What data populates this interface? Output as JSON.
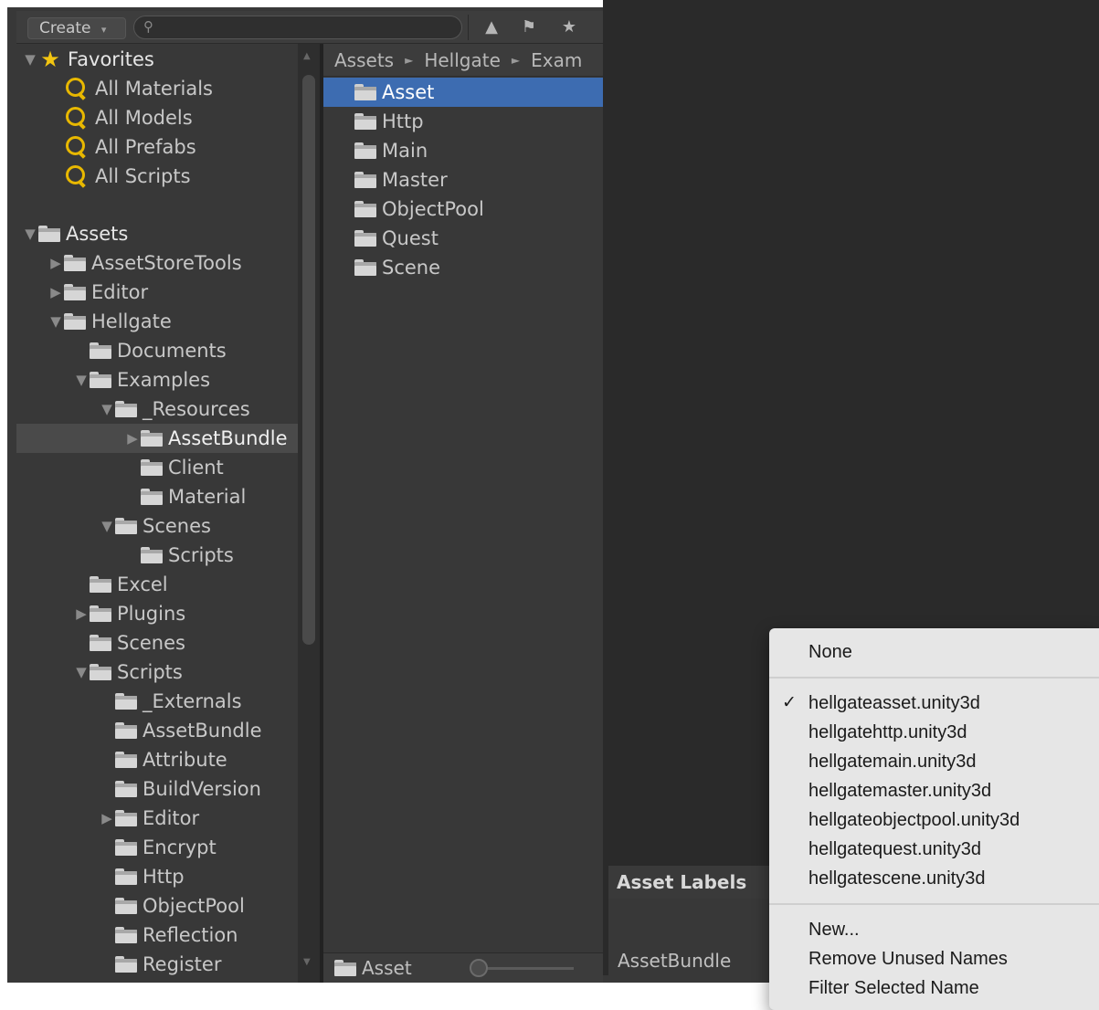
{
  "toolbar": {
    "create_label": "Create",
    "create_arrow": "▾",
    "search_placeholder": "",
    "icons": [
      "filter-by-type-icon",
      "filter-by-label-icon",
      "favorite-icon"
    ]
  },
  "favorites": {
    "title": "Favorites",
    "items": [
      "All Materials",
      "All Models",
      "All Prefabs",
      "All Scripts"
    ]
  },
  "tree": {
    "root": "Assets",
    "rows": [
      {
        "label": "AssetStoreTools",
        "depth": 1,
        "expander": "collapsed"
      },
      {
        "label": "Editor",
        "depth": 1,
        "expander": "collapsed"
      },
      {
        "label": "Hellgate",
        "depth": 1,
        "expander": "expanded"
      },
      {
        "label": "Documents",
        "depth": 2,
        "expander": "none"
      },
      {
        "label": "Examples",
        "depth": 2,
        "expander": "expanded"
      },
      {
        "label": "_Resources",
        "depth": 3,
        "expander": "expanded"
      },
      {
        "label": "AssetBundle",
        "depth": 4,
        "expander": "collapsed",
        "selected": true
      },
      {
        "label": "Client",
        "depth": 4,
        "expander": "none"
      },
      {
        "label": "Material",
        "depth": 4,
        "expander": "none"
      },
      {
        "label": "Scenes",
        "depth": 3,
        "expander": "expanded"
      },
      {
        "label": "Scripts",
        "depth": 4,
        "expander": "none"
      },
      {
        "label": "Excel",
        "depth": 2,
        "expander": "none"
      },
      {
        "label": "Plugins",
        "depth": 2,
        "expander": "collapsed"
      },
      {
        "label": "Scenes",
        "depth": 2,
        "expander": "none"
      },
      {
        "label": "Scripts",
        "depth": 2,
        "expander": "expanded"
      },
      {
        "label": "_Externals",
        "depth": 3,
        "expander": "none"
      },
      {
        "label": "AssetBundle",
        "depth": 3,
        "expander": "none"
      },
      {
        "label": "Attribute",
        "depth": 3,
        "expander": "none"
      },
      {
        "label": "BuildVersion",
        "depth": 3,
        "expander": "none"
      },
      {
        "label": "Editor",
        "depth": 3,
        "expander": "collapsed"
      },
      {
        "label": "Encrypt",
        "depth": 3,
        "expander": "none"
      },
      {
        "label": "Http",
        "depth": 3,
        "expander": "none"
      },
      {
        "label": "ObjectPool",
        "depth": 3,
        "expander": "none"
      },
      {
        "label": "Reflection",
        "depth": 3,
        "expander": "none"
      },
      {
        "label": "Register",
        "depth": 3,
        "expander": "none"
      }
    ]
  },
  "breadcrumb": [
    "Assets",
    "Hellgate",
    "Exam"
  ],
  "breadcrumb_sep": "►",
  "folders": [
    "Asset",
    "Http",
    "Main",
    "Master",
    "ObjectPool",
    "Quest",
    "Scene"
  ],
  "selected_folder_index": 0,
  "footer": {
    "selected_name": "Asset"
  },
  "inspector": {
    "labels_header": "Asset Labels",
    "bundle_label": "AssetBundle"
  },
  "menu": {
    "none_label": "None",
    "check_mark": "✓",
    "checked_index": 0,
    "bundles": [
      "hellgateasset.unity3d",
      "hellgatehttp.unity3d",
      "hellgatemain.unity3d",
      "hellgatemaster.unity3d",
      "hellgateobjectpool.unity3d",
      "hellgatequest.unity3d",
      "hellgatescene.unity3d"
    ],
    "actions": [
      "New...",
      "Remove Unused Names",
      "Filter Selected Name"
    ]
  }
}
